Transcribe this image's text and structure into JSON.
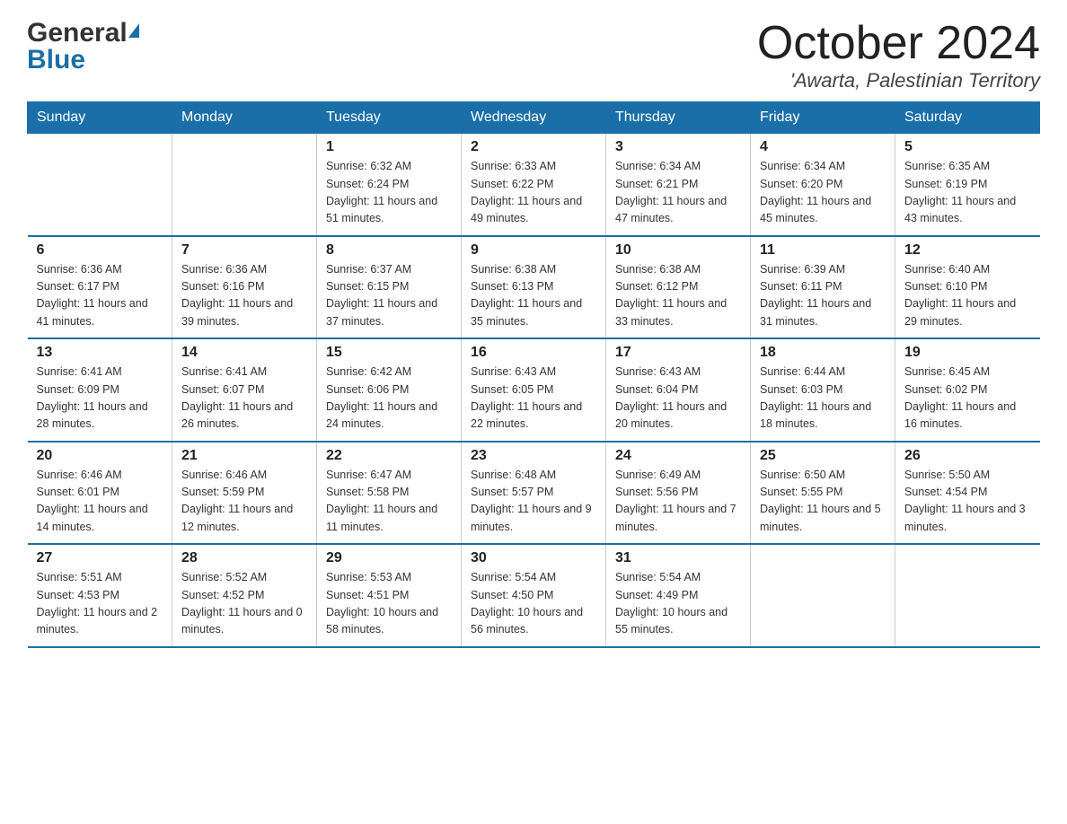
{
  "logo": {
    "general": "General",
    "blue": "Blue"
  },
  "header": {
    "month_year": "October 2024",
    "location": "'Awarta, Palestinian Territory"
  },
  "days_of_week": [
    "Sunday",
    "Monday",
    "Tuesday",
    "Wednesday",
    "Thursday",
    "Friday",
    "Saturday"
  ],
  "weeks": [
    [
      {
        "day": "",
        "info": ""
      },
      {
        "day": "",
        "info": ""
      },
      {
        "day": "1",
        "info": "Sunrise: 6:32 AM\nSunset: 6:24 PM\nDaylight: 11 hours\nand 51 minutes."
      },
      {
        "day": "2",
        "info": "Sunrise: 6:33 AM\nSunset: 6:22 PM\nDaylight: 11 hours\nand 49 minutes."
      },
      {
        "day": "3",
        "info": "Sunrise: 6:34 AM\nSunset: 6:21 PM\nDaylight: 11 hours\nand 47 minutes."
      },
      {
        "day": "4",
        "info": "Sunrise: 6:34 AM\nSunset: 6:20 PM\nDaylight: 11 hours\nand 45 minutes."
      },
      {
        "day": "5",
        "info": "Sunrise: 6:35 AM\nSunset: 6:19 PM\nDaylight: 11 hours\nand 43 minutes."
      }
    ],
    [
      {
        "day": "6",
        "info": "Sunrise: 6:36 AM\nSunset: 6:17 PM\nDaylight: 11 hours\nand 41 minutes."
      },
      {
        "day": "7",
        "info": "Sunrise: 6:36 AM\nSunset: 6:16 PM\nDaylight: 11 hours\nand 39 minutes."
      },
      {
        "day": "8",
        "info": "Sunrise: 6:37 AM\nSunset: 6:15 PM\nDaylight: 11 hours\nand 37 minutes."
      },
      {
        "day": "9",
        "info": "Sunrise: 6:38 AM\nSunset: 6:13 PM\nDaylight: 11 hours\nand 35 minutes."
      },
      {
        "day": "10",
        "info": "Sunrise: 6:38 AM\nSunset: 6:12 PM\nDaylight: 11 hours\nand 33 minutes."
      },
      {
        "day": "11",
        "info": "Sunrise: 6:39 AM\nSunset: 6:11 PM\nDaylight: 11 hours\nand 31 minutes."
      },
      {
        "day": "12",
        "info": "Sunrise: 6:40 AM\nSunset: 6:10 PM\nDaylight: 11 hours\nand 29 minutes."
      }
    ],
    [
      {
        "day": "13",
        "info": "Sunrise: 6:41 AM\nSunset: 6:09 PM\nDaylight: 11 hours\nand 28 minutes."
      },
      {
        "day": "14",
        "info": "Sunrise: 6:41 AM\nSunset: 6:07 PM\nDaylight: 11 hours\nand 26 minutes."
      },
      {
        "day": "15",
        "info": "Sunrise: 6:42 AM\nSunset: 6:06 PM\nDaylight: 11 hours\nand 24 minutes."
      },
      {
        "day": "16",
        "info": "Sunrise: 6:43 AM\nSunset: 6:05 PM\nDaylight: 11 hours\nand 22 minutes."
      },
      {
        "day": "17",
        "info": "Sunrise: 6:43 AM\nSunset: 6:04 PM\nDaylight: 11 hours\nand 20 minutes."
      },
      {
        "day": "18",
        "info": "Sunrise: 6:44 AM\nSunset: 6:03 PM\nDaylight: 11 hours\nand 18 minutes."
      },
      {
        "day": "19",
        "info": "Sunrise: 6:45 AM\nSunset: 6:02 PM\nDaylight: 11 hours\nand 16 minutes."
      }
    ],
    [
      {
        "day": "20",
        "info": "Sunrise: 6:46 AM\nSunset: 6:01 PM\nDaylight: 11 hours\nand 14 minutes."
      },
      {
        "day": "21",
        "info": "Sunrise: 6:46 AM\nSunset: 5:59 PM\nDaylight: 11 hours\nand 12 minutes."
      },
      {
        "day": "22",
        "info": "Sunrise: 6:47 AM\nSunset: 5:58 PM\nDaylight: 11 hours\nand 11 minutes."
      },
      {
        "day": "23",
        "info": "Sunrise: 6:48 AM\nSunset: 5:57 PM\nDaylight: 11 hours\nand 9 minutes."
      },
      {
        "day": "24",
        "info": "Sunrise: 6:49 AM\nSunset: 5:56 PM\nDaylight: 11 hours\nand 7 minutes."
      },
      {
        "day": "25",
        "info": "Sunrise: 6:50 AM\nSunset: 5:55 PM\nDaylight: 11 hours\nand 5 minutes."
      },
      {
        "day": "26",
        "info": "Sunrise: 5:50 AM\nSunset: 4:54 PM\nDaylight: 11 hours\nand 3 minutes."
      }
    ],
    [
      {
        "day": "27",
        "info": "Sunrise: 5:51 AM\nSunset: 4:53 PM\nDaylight: 11 hours\nand 2 minutes."
      },
      {
        "day": "28",
        "info": "Sunrise: 5:52 AM\nSunset: 4:52 PM\nDaylight: 11 hours\nand 0 minutes."
      },
      {
        "day": "29",
        "info": "Sunrise: 5:53 AM\nSunset: 4:51 PM\nDaylight: 10 hours\nand 58 minutes."
      },
      {
        "day": "30",
        "info": "Sunrise: 5:54 AM\nSunset: 4:50 PM\nDaylight: 10 hours\nand 56 minutes."
      },
      {
        "day": "31",
        "info": "Sunrise: 5:54 AM\nSunset: 4:49 PM\nDaylight: 10 hours\nand 55 minutes."
      },
      {
        "day": "",
        "info": ""
      },
      {
        "day": "",
        "info": ""
      }
    ]
  ]
}
